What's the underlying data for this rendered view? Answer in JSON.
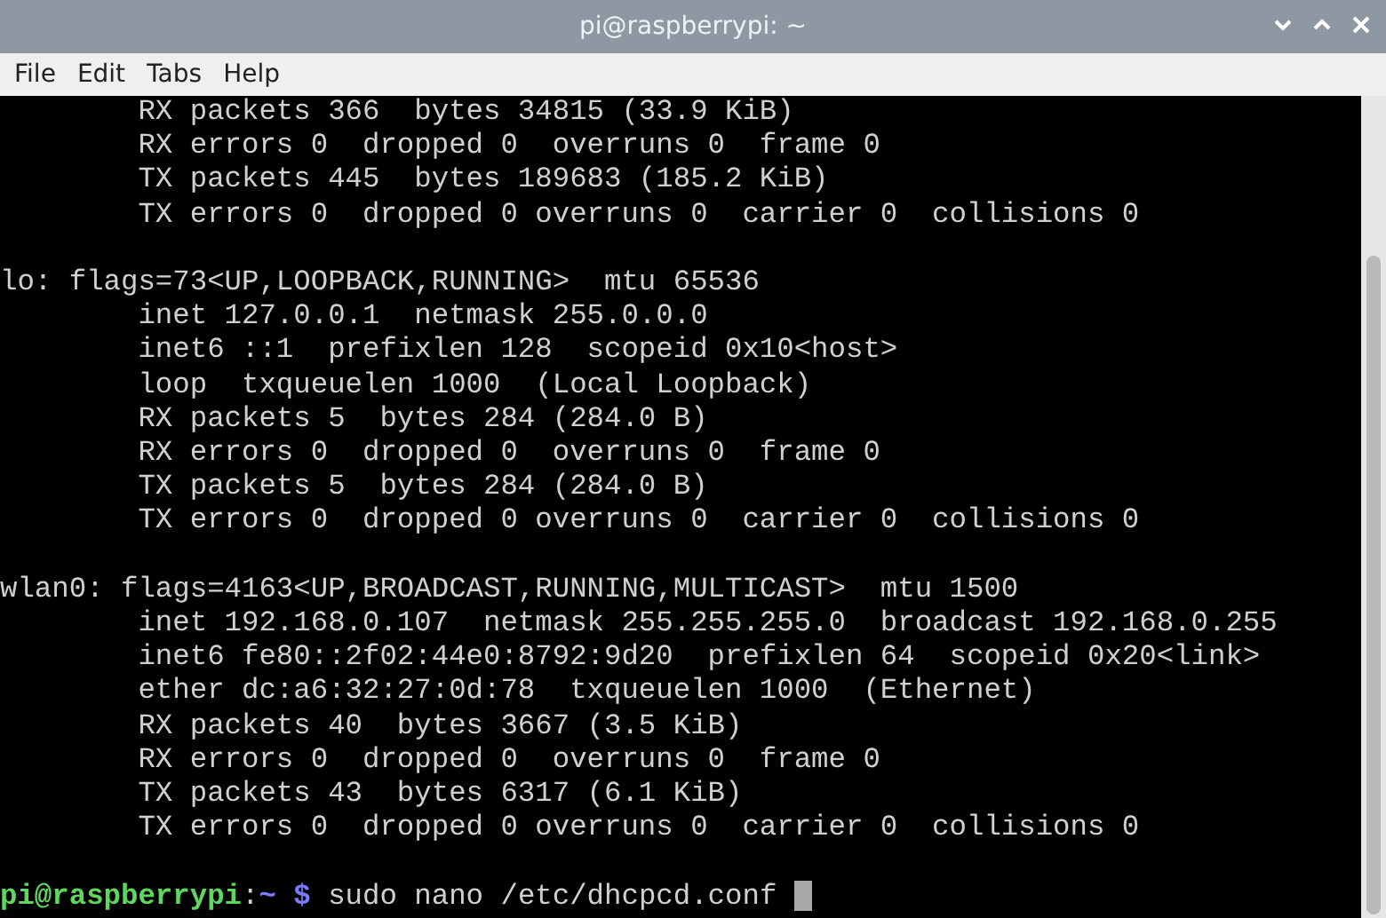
{
  "window": {
    "title": "pi@raspberrypi: ~"
  },
  "menu": [
    "File",
    "Edit",
    "Tabs",
    "Help"
  ],
  "terminal": {
    "blocks": [
      [
        "        RX packets 366  bytes 34815 (33.9 KiB)",
        "        RX errors 0  dropped 0  overruns 0  frame 0",
        "        TX packets 445  bytes 189683 (185.2 KiB)",
        "        TX errors 0  dropped 0 overruns 0  carrier 0  collisions 0"
      ],
      [
        "lo: flags=73<UP,LOOPBACK,RUNNING>  mtu 65536",
        "        inet 127.0.0.1  netmask 255.0.0.0",
        "        inet6 ::1  prefixlen 128  scopeid 0x10<host>",
        "        loop  txqueuelen 1000  (Local Loopback)",
        "        RX packets 5  bytes 284 (284.0 B)",
        "        RX errors 0  dropped 0  overruns 0  frame 0",
        "        TX packets 5  bytes 284 (284.0 B)",
        "        TX errors 0  dropped 0 overruns 0  carrier 0  collisions 0"
      ],
      [
        "wlan0: flags=4163<UP,BROADCAST,RUNNING,MULTICAST>  mtu 1500",
        "        inet 192.168.0.107  netmask 255.255.255.0  broadcast 192.168.0.255",
        "        inet6 fe80::2f02:44e0:8792:9d20  prefixlen 64  scopeid 0x20<link>",
        "        ether dc:a6:32:27:0d:78  txqueuelen 1000  (Ethernet)",
        "        RX packets 40  bytes 3667 (3.5 KiB)",
        "        RX errors 0  dropped 0  overruns 0  frame 0",
        "        TX packets 43  bytes 6317 (6.1 KiB)",
        "        TX errors 0  dropped 0 overruns 0  carrier 0  collisions 0"
      ]
    ]
  },
  "prompt": {
    "user_host": "pi@raspberrypi",
    "separator": ":",
    "path": "~",
    "symbol": "$",
    "command": "sudo nano /etc/dhcpcd.conf",
    "cursor": true
  }
}
